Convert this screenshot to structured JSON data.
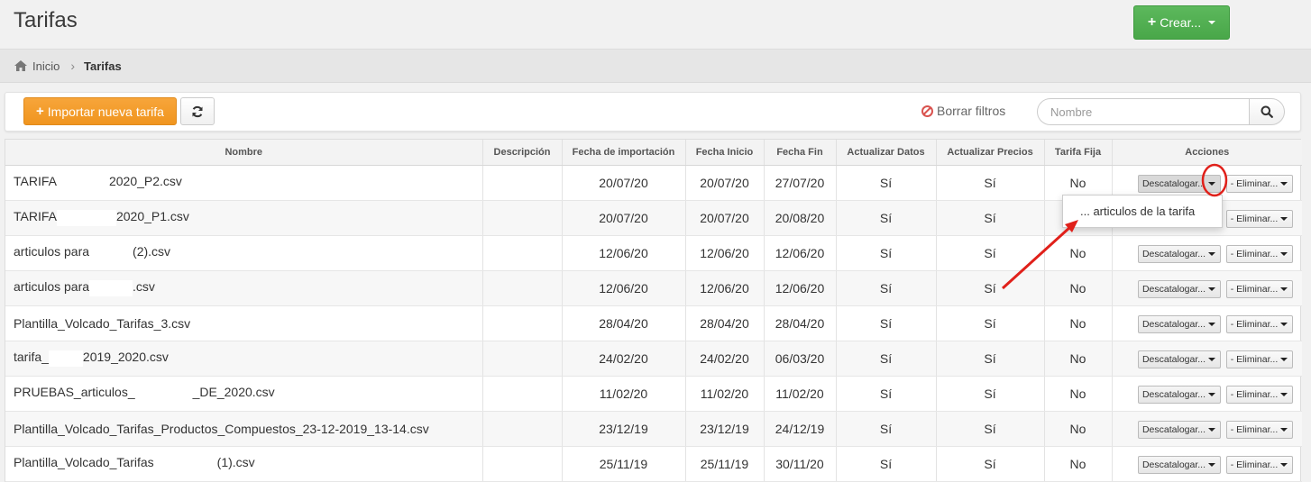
{
  "header": {
    "title": "Tarifas",
    "create_label": "Crear..."
  },
  "breadcrumb": {
    "home": "Inicio",
    "current": "Tarifas"
  },
  "toolbar": {
    "import_label": "Importar nueva tarifa",
    "clear_filters_label": "Borrar filtros"
  },
  "search": {
    "placeholder": "Nombre"
  },
  "table": {
    "columns": [
      "Nombre",
      "Descripción",
      "Fecha de importación",
      "Fecha Inicio",
      "Fecha Fin",
      "Actualizar Datos",
      "Actualizar Precios",
      "Tarifa Fija",
      "Acciones"
    ],
    "rows": [
      {
        "name_a": "TARIFA",
        "name_b": "2020_P2.csv",
        "desc": "",
        "import": "20/07/20",
        "start": "20/07/20",
        "end": "27/07/20",
        "upd_data": "Sí",
        "upd_prices": "Sí",
        "fixed": "No"
      },
      {
        "name_a": "TARIFA",
        "name_b": "2020_P1.csv",
        "desc": "",
        "import": "20/07/20",
        "start": "20/07/20",
        "end": "20/08/20",
        "upd_data": "Sí",
        "upd_prices": "Sí",
        "fixed": "No"
      },
      {
        "name_a": "articulos para",
        "name_b": "(2).csv",
        "desc": "",
        "import": "12/06/20",
        "start": "12/06/20",
        "end": "12/06/20",
        "upd_data": "Sí",
        "upd_prices": "Sí",
        "fixed": "No"
      },
      {
        "name_a": "articulos para",
        "name_b": ".csv",
        "desc": "",
        "import": "12/06/20",
        "start": "12/06/20",
        "end": "12/06/20",
        "upd_data": "Sí",
        "upd_prices": "Sí",
        "fixed": "No"
      },
      {
        "name_a": "Plantilla_Volcado_Tarifas_3.csv",
        "name_b": "",
        "desc": "",
        "import": "28/04/20",
        "start": "28/04/20",
        "end": "28/04/20",
        "upd_data": "Sí",
        "upd_prices": "Sí",
        "fixed": "No"
      },
      {
        "name_a": "tarifa_",
        "name_b": "2019_2020.csv",
        "desc": "",
        "import": "24/02/20",
        "start": "24/02/20",
        "end": "06/03/20",
        "upd_data": "Sí",
        "upd_prices": "Sí",
        "fixed": "No"
      },
      {
        "name_a": "PRUEBAS_articulos_",
        "name_b": "_DE_2020.csv",
        "desc": "",
        "import": "11/02/20",
        "start": "11/02/20",
        "end": "11/02/20",
        "upd_data": "Sí",
        "upd_prices": "Sí",
        "fixed": "No"
      },
      {
        "name_a": "Plantilla_Volcado_Tarifas_Productos_Compuestos_23-12-2019_13-14.csv",
        "name_b": "",
        "desc": "",
        "import": "23/12/19",
        "start": "23/12/19",
        "end": "24/12/19",
        "upd_data": "Sí",
        "upd_prices": "Sí",
        "fixed": "No"
      },
      {
        "name_a": "Plantilla_Volcado_Tarifas",
        "name_b": "(1).csv",
        "desc": "",
        "import": "25/11/19",
        "start": "25/11/19",
        "end": "30/11/20",
        "upd_data": "Sí",
        "upd_prices": "Sí",
        "fixed": "No"
      }
    ],
    "action_labels": {
      "discontinue": "Descatalogar...",
      "delete": "- Eliminar..."
    }
  },
  "dropdown": {
    "item": "... articulos de la tarifa"
  },
  "colors": {
    "create_green": "#5cb85c",
    "import_orange": "#f0951f",
    "annotation_red": "#e0201a"
  }
}
